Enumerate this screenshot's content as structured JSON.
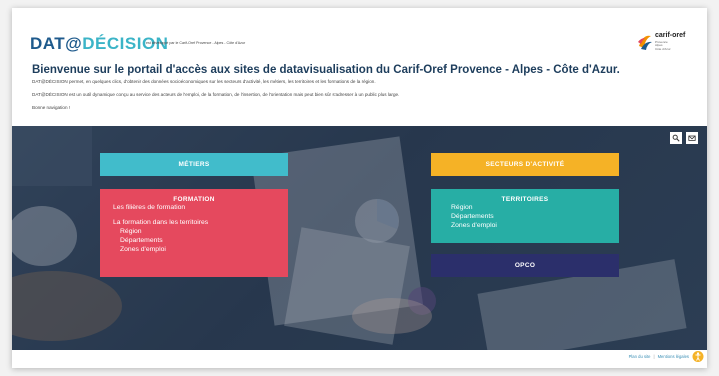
{
  "brand": {
    "logo_part1": "DAT@",
    "logo_part2": "DÉCISION",
    "logo_subtitle": "est développé par le Carif-Oref Provence - Alpes - Côte d'Azur",
    "partner_logo_name": "carif-oref",
    "partner_logo_tagline_1": "Provence",
    "partner_logo_tagline_2": "Alpes",
    "partner_logo_tagline_3": "Côte d'Azur"
  },
  "intro": {
    "headline": "Bienvenue sur le portail d'accès aux sites de datavisualisation du Carif-Oref Provence - Alpes - Côte d'Azur.",
    "para1": "DAT@DÉCISION permet, en quelques clics, d'obtenir des données socioéconomiques sur les secteurs d'activité, les métiers, les territoires et les formations de la région.",
    "para2": "DAT@DÉCISION est un outil dynamique conçu au service des acteurs de l'emploi, de la formation, de l'insertion, de l'orientation mais peut bien sûr s'adresser à un public plus large.",
    "para3": "Bonne navigation !"
  },
  "tiles": {
    "metiers": "MÉTIERS",
    "secteurs": "SECTEURS D'ACTIVITÉ",
    "formation": {
      "title": "FORMATION",
      "links": [
        "Les filières de formation",
        "La formation dans les territoires",
        "Région",
        "Départements",
        "Zones d'emploi"
      ]
    },
    "territoires": {
      "title": "TERRITOIRES",
      "links": [
        "Région",
        "Départements",
        "Zones d'emploi"
      ]
    },
    "opco": "OPCO"
  },
  "toolbar": {
    "search_icon": "search-icon",
    "mail_icon": "mail-icon"
  },
  "footer": {
    "sitemap": "Plan du site",
    "legal": "Mentions légales",
    "accessibility_icon": "accessibility-icon"
  },
  "colors": {
    "metiers": "#41bccb",
    "secteurs": "#f5b226",
    "formation": "#e5495e",
    "territoires": "#27aea5",
    "opco": "#2b2f6b",
    "logo_dark": "#1e5a8c",
    "logo_light": "#3bb4c7"
  }
}
